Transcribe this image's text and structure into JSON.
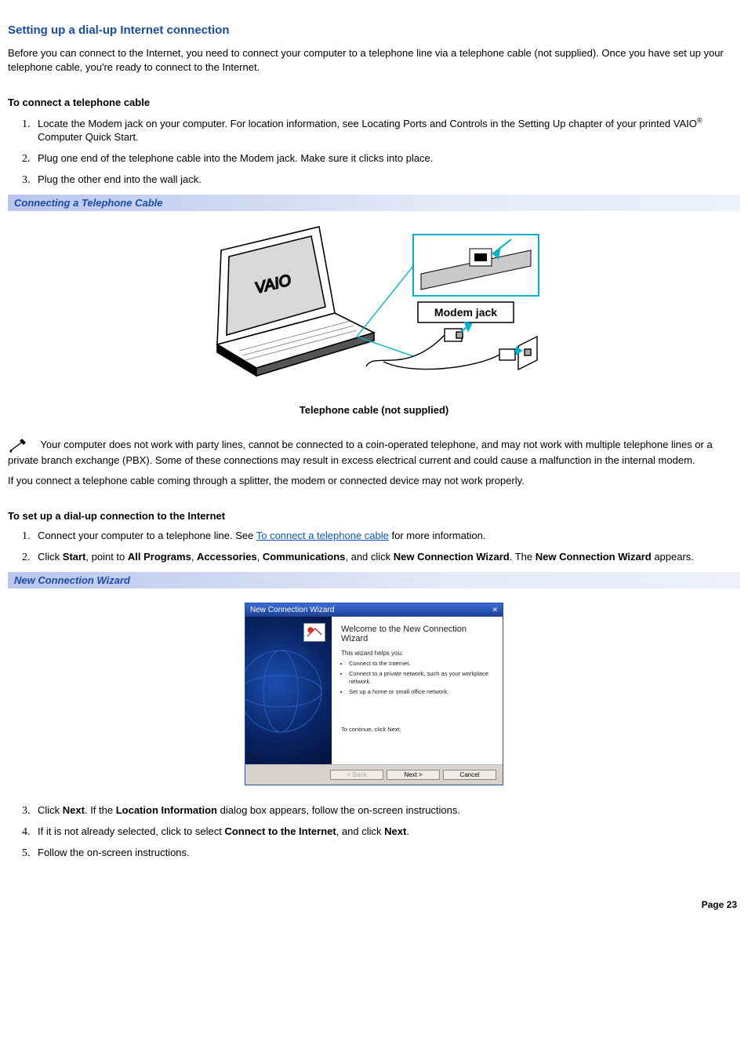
{
  "title": "Setting up a dial-up Internet connection",
  "intro": "Before you can connect to the Internet, you need to connect your computer to a telephone line via a telephone cable (not supplied). Once you have set up your telephone cable, you're ready to connect to the Internet.",
  "sub1": "To connect a telephone cable",
  "steps1": {
    "s1a": "Locate the Modem jack on your computer. For location information, see Locating Ports and Controls in the Setting Up chapter of your printed VAIO",
    "s1b": " Computer Quick Start.",
    "s2": "Plug one end of the telephone cable into the Modem jack. Make sure it clicks into place.",
    "s3": "Plug the other end into the wall jack."
  },
  "caption1": "Connecting a Telephone Cable",
  "fig1": {
    "label_modem": "Modem jack",
    "caption": "Telephone cable (not supplied)"
  },
  "note1": "Your computer does not work with party lines, cannot be connected to a coin-operated telephone, and may not work with multiple telephone lines or a private branch exchange (PBX). Some of these connections may result in excess electrical current and could cause a malfunction in the internal modem.",
  "note2": "If you connect a telephone cable coming through a splitter, the modem or connected device may not work properly.",
  "sub2": "To set up a dial-up connection to the Internet",
  "steps2": {
    "s1a": "Connect your computer to a telephone line. See ",
    "s1link": "To connect a telephone cable",
    "s1b": " for more information.",
    "s2a": "Click ",
    "s2b": "Start",
    "s2c": ", point to ",
    "s2d": "All Programs",
    "s2e": ", ",
    "s2f": "Accessories",
    "s2g": ", ",
    "s2h": "Communications",
    "s2i": ", and click ",
    "s2j": "New Connection Wizard",
    "s2k": ". The ",
    "s2l": "New Connection Wizard",
    "s2m": " appears.",
    "s3a": "Click ",
    "s3b": "Next",
    "s3c": ". If the ",
    "s3d": "Location Information",
    "s3e": " dialog box appears, follow the on-screen instructions.",
    "s4a": "If it is not already selected, click to select ",
    "s4b": "Connect to the Internet",
    "s4c": ", and click ",
    "s4d": "Next",
    "s4e": ".",
    "s5": "Follow the on-screen instructions."
  },
  "caption2": "New Connection Wizard",
  "wizard": {
    "titlebar": "New Connection Wizard",
    "heading": "Welcome to the New Connection Wizard",
    "lede": "This wizard helps you:",
    "b1": "Connect to the Internet.",
    "b2": "Connect to a private network, such as your workplace network.",
    "b3": "Set up a home or small office network.",
    "cont": "To continue, click Next.",
    "back": "< Back",
    "next": "Next >",
    "cancel": "Cancel"
  },
  "page": "Page 23"
}
